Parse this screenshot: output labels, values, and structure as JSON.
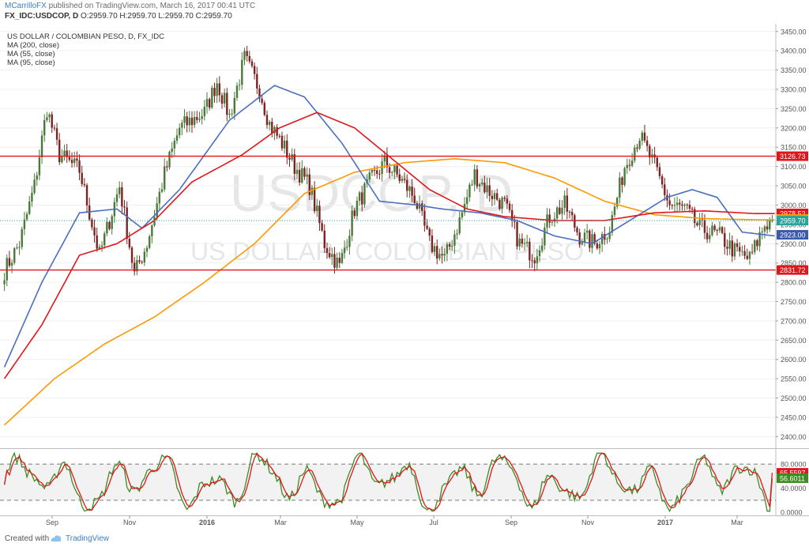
{
  "header": {
    "author": "MCarrilloFX",
    "published": "published on TradingView.com, March 16, 2017 00:41 UTC",
    "symbol": "FX_IDC:USDCOP, D",
    "ohlc": "O:2959.70 H:2959.70 L:2959.70 C:2959.70"
  },
  "legend": {
    "title": "US DOLLAR / COLOMBIAN PESO, D, FX_IDC",
    "ma200": "MA (200, close)",
    "ma55": "MA (55, close)",
    "ma95": "MA (95, close)"
  },
  "watermark": {
    "big": "USDCOP, D",
    "small": "US DOLLAR / COLOMBIAN PESO"
  },
  "footer": {
    "created": "Created with",
    "brand": "TradingView"
  },
  "colors": {
    "up": "#4a7a3a",
    "down": "#7a2424",
    "ma200": "#ff9800",
    "ma55": "#4a6fbf",
    "ma95": "#e0161b",
    "level": "#e0161b",
    "stoch_k": "#3d8b22",
    "stoch_d": "#e0161b"
  },
  "chart_data": {
    "type": "candlestick",
    "x_ticks": [
      "Sep",
      "Nov",
      "2016",
      "Mar",
      "May",
      "Jul",
      "Sep",
      "Nov",
      "2017",
      "Mar"
    ],
    "price_axis": {
      "ylim": [
        2370,
        3470
      ],
      "ticks": [
        "3450.00",
        "3400.00",
        "3350.00",
        "3300.00",
        "3250.00",
        "3200.00",
        "3150.00",
        "3100.00",
        "3050.00",
        "3000.00",
        "2950.00",
        "2900.00",
        "2850.00",
        "2800.00",
        "2750.00",
        "2700.00",
        "2650.00",
        "2600.00",
        "2550.00",
        "2500.00",
        "2450.00",
        "2400.00"
      ]
    },
    "horizontal_levels": [
      3126.73,
      2831.72
    ],
    "price_labels": [
      {
        "text": "3126.73",
        "value": 3126.73,
        "color": "#e0161b"
      },
      {
        "text": "2978.52",
        "value": 2978.52,
        "color": "#e0161b"
      },
      {
        "text": "2964.12",
        "value": 2964.12,
        "color": "#ff9800"
      },
      {
        "text": "2959.70",
        "value": 2959.7,
        "color": "#26a69a"
      },
      {
        "text": "2923.00",
        "value": 2923.0,
        "color": "#3b5aa8"
      },
      {
        "text": "2831.72",
        "value": 2831.72,
        "color": "#e0161b"
      }
    ],
    "last_price": 2959.7,
    "close_waypoints": [
      [
        0,
        2830
      ],
      [
        6,
        2900
      ],
      [
        12,
        3050
      ],
      [
        17,
        3250
      ],
      [
        22,
        3130
      ],
      [
        30,
        3090
      ],
      [
        38,
        2870
      ],
      [
        46,
        3050
      ],
      [
        52,
        2820
      ],
      [
        57,
        2900
      ],
      [
        64,
        3080
      ],
      [
        70,
        3200
      ],
      [
        80,
        3240
      ],
      [
        85,
        3320
      ],
      [
        90,
        3230
      ],
      [
        96,
        3380
      ],
      [
        102,
        3300
      ],
      [
        106,
        3210
      ],
      [
        111,
        3160
      ],
      [
        116,
        3100
      ],
      [
        122,
        3050
      ],
      [
        128,
        2900
      ],
      [
        134,
        2840
      ],
      [
        140,
        2990
      ],
      [
        146,
        3060
      ],
      [
        152,
        3110
      ],
      [
        158,
        3070
      ],
      [
        164,
        3020
      ],
      [
        170,
        2900
      ],
      [
        176,
        2860
      ],
      [
        182,
        2960
      ],
      [
        188,
        3080
      ],
      [
        193,
        3040
      ],
      [
        200,
        3000
      ],
      [
        206,
        2900
      ],
      [
        212,
        2870
      ],
      [
        218,
        2970
      ],
      [
        224,
        3000
      ],
      [
        230,
        2920
      ],
      [
        236,
        2900
      ],
      [
        242,
        2940
      ],
      [
        248,
        3100
      ],
      [
        254,
        3180
      ],
      [
        260,
        3100
      ],
      [
        266,
        3000
      ],
      [
        272,
        2990
      ],
      [
        278,
        2940
      ],
      [
        286,
        2920
      ],
      [
        292,
        2880
      ],
      [
        298,
        2860
      ],
      [
        304,
        2950
      ],
      [
        308,
        2960
      ]
    ],
    "ma_series": [
      {
        "name": "MA (200, close)",
        "color": "#ff9800",
        "points": [
          [
            0,
            2430
          ],
          [
            20,
            2550
          ],
          [
            40,
            2640
          ],
          [
            60,
            2710
          ],
          [
            80,
            2800
          ],
          [
            100,
            2900
          ],
          [
            120,
            3030
          ],
          [
            140,
            3085
          ],
          [
            160,
            3110
          ],
          [
            180,
            3120
          ],
          [
            200,
            3110
          ],
          [
            220,
            3070
          ],
          [
            240,
            3010
          ],
          [
            260,
            2975
          ],
          [
            280,
            2965
          ],
          [
            300,
            2962
          ],
          [
            308,
            2962
          ]
        ]
      },
      {
        "name": "MA (55, close)",
        "color": "#4a6fbf",
        "points": [
          [
            0,
            2580
          ],
          [
            15,
            2800
          ],
          [
            30,
            2980
          ],
          [
            45,
            2990
          ],
          [
            55,
            2940
          ],
          [
            70,
            3040
          ],
          [
            90,
            3220
          ],
          [
            108,
            3310
          ],
          [
            120,
            3280
          ],
          [
            135,
            3160
          ],
          [
            150,
            3010
          ],
          [
            165,
            3000
          ],
          [
            175,
            2990
          ],
          [
            190,
            2980
          ],
          [
            205,
            2960
          ],
          [
            220,
            2920
          ],
          [
            235,
            2900
          ],
          [
            250,
            2960
          ],
          [
            265,
            3020
          ],
          [
            275,
            3040
          ],
          [
            285,
            3020
          ],
          [
            295,
            2930
          ],
          [
            308,
            2920
          ]
        ]
      },
      {
        "name": "MA (95, close)",
        "color": "#e0161b",
        "points": [
          [
            0,
            2550
          ],
          [
            15,
            2690
          ],
          [
            30,
            2870
          ],
          [
            45,
            2900
          ],
          [
            60,
            2960
          ],
          [
            75,
            3060
          ],
          [
            95,
            3130
          ],
          [
            110,
            3200
          ],
          [
            125,
            3240
          ],
          [
            140,
            3200
          ],
          [
            155,
            3120
          ],
          [
            170,
            3040
          ],
          [
            185,
            2990
          ],
          [
            200,
            2970
          ],
          [
            220,
            2960
          ],
          [
            240,
            2960
          ],
          [
            260,
            2980
          ],
          [
            280,
            2985
          ],
          [
            300,
            2978
          ],
          [
            308,
            2978
          ]
        ]
      }
    ],
    "stochastic": {
      "ylim": [
        -5,
        105
      ],
      "ticks": [
        "80.0000",
        "40.0000",
        "0.0000"
      ],
      "dashed_levels": [
        80,
        20
      ],
      "k_label": "56.6011",
      "d_label": "65.5597",
      "k_value": 56.6011,
      "d_value": 65.5597
    }
  }
}
